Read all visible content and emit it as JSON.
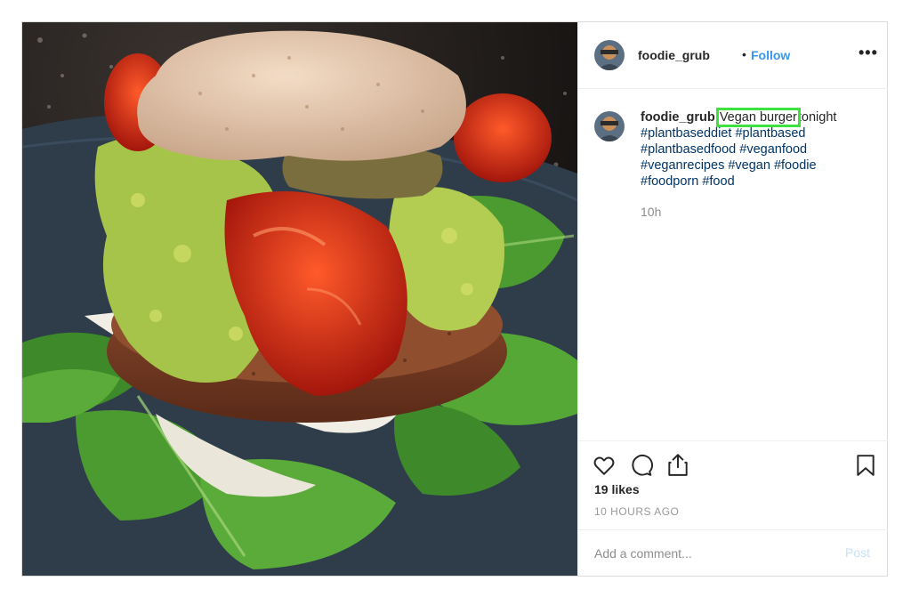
{
  "post": {
    "username": "foodie_grub",
    "follow_label": "Follow",
    "separator": "•",
    "more_label": "•••"
  },
  "caption": {
    "username": "foodie_grub",
    "highlighted_text": "Vegan burger",
    "text_after": "tonight",
    "hashtags": [
      "#plantbaseddiet",
      "#plantbased",
      "#plantbasedfood",
      "#veganfood",
      "#veganrecipes",
      "#vegan",
      "#foodie",
      "#foodporn",
      "#food"
    ],
    "time": "10h"
  },
  "actions": {
    "likes": "19 likes",
    "age": "10 HOURS AGO"
  },
  "comment_box": {
    "placeholder": "Add a comment...",
    "post_label": "Post"
  },
  "colors": {
    "follow": "#3897f0",
    "hashtag": "#003569",
    "highlight": "#40e040",
    "post_disabled": "#c7dff8"
  }
}
